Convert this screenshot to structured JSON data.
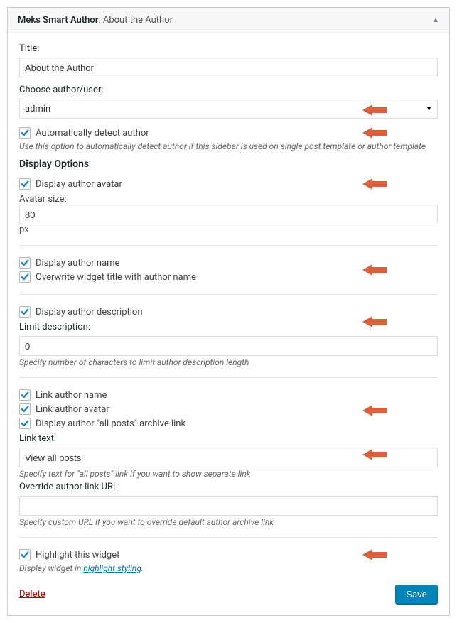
{
  "header": {
    "title_strong": "Meks Smart Author",
    "title_suffix": ": About the Author"
  },
  "title": {
    "label": "Title:",
    "value": "About the Author"
  },
  "author": {
    "label": "Choose author/user:",
    "value": "admin"
  },
  "auto_detect": {
    "label": "Automatically detect author",
    "help": "Use this option to automatically detect author if this sidebar is used on single post template or author template"
  },
  "display_options_heading": "Display Options",
  "avatar": {
    "display_label": "Display author avatar",
    "size_label": "Avatar size:",
    "size_value": "80",
    "unit": "px"
  },
  "name": {
    "display_label": "Display author name",
    "overwrite_label": "Overwrite widget title with author name"
  },
  "description": {
    "display_label": "Display author description",
    "limit_label": "Limit description:",
    "limit_value": "0",
    "help": "Specify number of characters to limit author description length"
  },
  "links": {
    "link_name": "Link author name",
    "link_avatar": "Link author avatar",
    "all_posts": "Display author \"all posts\" archive link",
    "link_text_label": "Link text:",
    "link_text_value": "View all posts",
    "link_text_help": "Specify text for \"all posts\" link if you want to show separate link",
    "override_label": "Override author link URL:",
    "override_value": "",
    "override_help": "Specify custom URL if you want to override default author archive link"
  },
  "highlight": {
    "label": "Highlight this widget",
    "help_pre": "Display widget in ",
    "help_link": "highlight styling",
    "help_post": "."
  },
  "footer": {
    "delete": "Delete",
    "save": "Save"
  }
}
